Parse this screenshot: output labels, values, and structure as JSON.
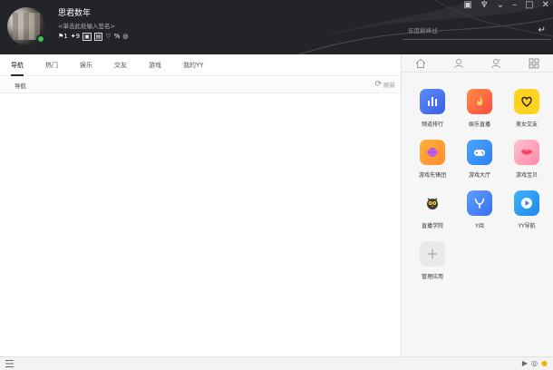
{
  "profile": {
    "nickname": "思君数年",
    "signature": "<单击此处输入签名>",
    "badges": [
      "⚑1",
      "✦9",
      "▣",
      "▤",
      "♡",
      "%",
      "◎"
    ]
  },
  "window_controls": [
    "▣",
    "♆",
    "⌄",
    "–",
    "□",
    "✕"
  ],
  "search": {
    "placeholder": "年度巅峰战",
    "enter_icon": "↵"
  },
  "nav": {
    "tabs": [
      {
        "label": "导航",
        "active": true
      },
      {
        "label": "热门"
      },
      {
        "label": "娱乐"
      },
      {
        "label": "交友"
      },
      {
        "label": "游戏"
      },
      {
        "label": "我的YY"
      }
    ]
  },
  "subbar": {
    "crumb": "导航",
    "refresh_icon": "⟳",
    "refresh_label": "刷新"
  },
  "right_panel": {
    "tabs": [
      "home-icon",
      "contact-icon",
      "group-icon",
      "apps-grid-icon"
    ],
    "apps": [
      {
        "label": "频道排行",
        "icon": "bar-chart-icon",
        "color": "#4a76f0"
      },
      {
        "label": "娱乐直播",
        "icon": "flame-icon",
        "color": "#ff6a3d"
      },
      {
        "label": "美女交友",
        "icon": "heart-icon",
        "color": "#ffd21f"
      },
      {
        "label": "游戏先锋团",
        "icon": "planet-icon",
        "color": "#8a5cf5"
      },
      {
        "label": "游戏大厅",
        "icon": "gamepad-icon",
        "color": "#3a8ff5"
      },
      {
        "label": "游戏宝贝",
        "icon": "lips-icon",
        "color": "#ff5f86"
      },
      {
        "label": "直播学院",
        "icon": "owl-icon",
        "color": "#f3f3f3"
      },
      {
        "label": "Y阅",
        "icon": "y-logo-icon",
        "color": "#4e8df5"
      },
      {
        "label": "YY导航",
        "icon": "play-icon",
        "color": "#2f9bf3"
      },
      {
        "label": "管理应用",
        "icon": "plus-icon",
        "color": "#e9e9e9"
      }
    ]
  },
  "status": {
    "right_icons": [
      "▶",
      "◎",
      "●"
    ]
  }
}
